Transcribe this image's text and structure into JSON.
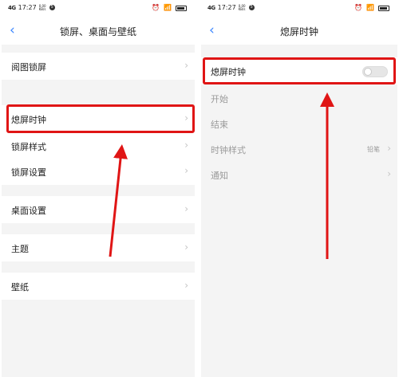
{
  "left": {
    "status": {
      "time": "17:27",
      "signal": "4G",
      "speed": "0.00 KB/s",
      "notif": "5"
    },
    "title": "锁屏、桌面与壁纸",
    "items": [
      {
        "label": "阅图锁屏"
      },
      {
        "label": "熄屏时钟"
      },
      {
        "label": "锁屏样式"
      },
      {
        "label": "锁屏设置"
      },
      {
        "label": "桌面设置"
      },
      {
        "label": "主题"
      },
      {
        "label": "壁纸"
      }
    ]
  },
  "right": {
    "status": {
      "time": "17:27",
      "signal": "4G",
      "speed": "0.00 KB/s",
      "notif": "5"
    },
    "title": "熄屏时钟",
    "items": [
      {
        "label": "熄屏时钟",
        "toggle": false
      },
      {
        "label": "开始"
      },
      {
        "label": "结束"
      },
      {
        "label": "时钟样式",
        "value": "铅笔"
      },
      {
        "label": "通知"
      }
    ]
  },
  "icons": [
    "back-arrow-icon",
    "chevron-right-icon",
    "alarm-icon",
    "wifi-icon",
    "battery-icon"
  ],
  "colors": {
    "highlight": "#e01515",
    "accent": "#3b86ff",
    "background": "#f4f4f4"
  }
}
